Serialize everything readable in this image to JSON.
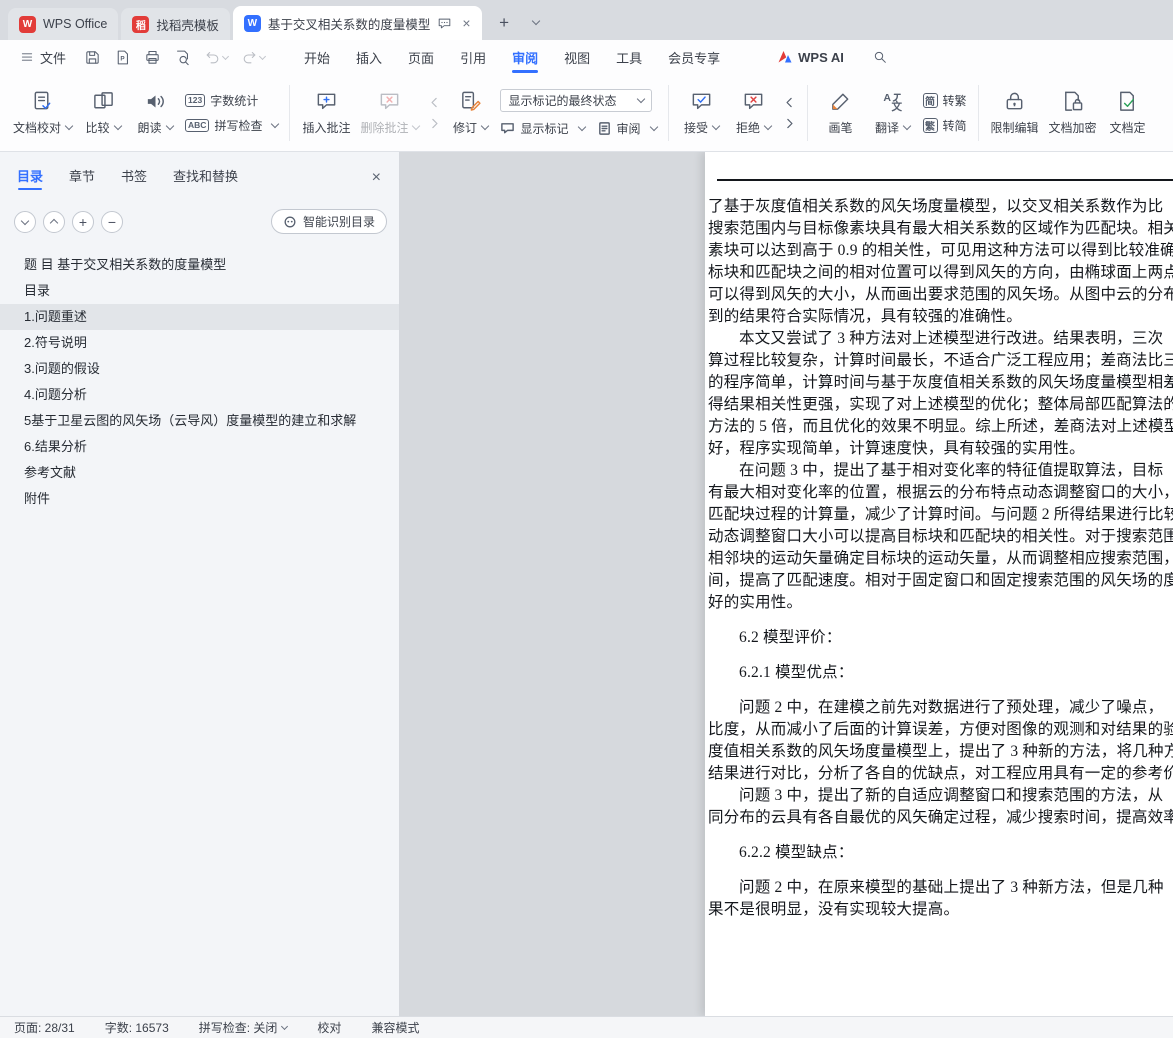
{
  "colors": {
    "accent_blue": "#3370ff",
    "brand_red": "#e23c39",
    "accept_blue": "#2f6ef2",
    "reject_red": "#e04444",
    "final_green": "#2aa158",
    "pen_orange": "#e8833a"
  },
  "tabbar": {
    "wps_tab": "WPS Office",
    "template_tab": "找稻壳模板",
    "doc_tab": "基于交叉相关系数的度量模型"
  },
  "menubar": {
    "file": "文件",
    "tabs": [
      {
        "label": "开始"
      },
      {
        "label": "插入"
      },
      {
        "label": "页面"
      },
      {
        "label": "引用"
      },
      {
        "label": "审阅",
        "active": true
      },
      {
        "label": "视图"
      },
      {
        "label": "工具"
      },
      {
        "label": "会员专享"
      }
    ],
    "wps_ai": "WPS AI"
  },
  "ribbon": {
    "doc_proof": "文档校对",
    "compare": "比较",
    "read_aloud": "朗读",
    "word_count": "字数统计",
    "word_count_badge": "123",
    "spell_check": "拼写检查",
    "spell_badge": "ABC",
    "insert_comment": "插入批注",
    "delete_comment": "删除批注",
    "revise": "修订",
    "markup_state": "显示标记的最终状态",
    "show_markup": "显示标记",
    "review": "审阅",
    "accept": "接受",
    "reject": "拒绝",
    "pen": "画笔",
    "translate": "翻译",
    "simp_char": "简",
    "to_trad": "转繁",
    "trad_char": "繁",
    "to_simp": "转简",
    "restrict_edit": "限制编辑",
    "doc_encrypt": "文档加密",
    "doc_final": "文档定"
  },
  "sidebar": {
    "tabs": [
      {
        "label": "目录",
        "active": true
      },
      {
        "label": "章节"
      },
      {
        "label": "书签"
      },
      {
        "label": "查找和替换"
      }
    ],
    "smart_toc": "智能识别目录",
    "toc": [
      {
        "label": "题 目 基于交叉相关系数的度量模型"
      },
      {
        "label": "目录"
      },
      {
        "label": "1.问题重述",
        "selected": true
      },
      {
        "label": "2.符号说明"
      },
      {
        "label": "3.问题的假设"
      },
      {
        "label": "4.问题分析"
      },
      {
        "label": "5基于卫星云图的风矢场（云导风）度量模型的建立和求解"
      },
      {
        "label": "6.结果分析"
      },
      {
        "label": "参考文献"
      },
      {
        "label": "附件"
      }
    ]
  },
  "document": {
    "lines": [
      {
        "t": "了基于灰度值相关系数的风矢场度量模型，以交叉相关系数作为比"
      },
      {
        "t": "搜索范围内与目标像素块具有最大相关系数的区域作为匹配块。相关"
      },
      {
        "t": "素块可以达到高于 0.9 的相关性，可见用这种方法可以得到比较准确"
      },
      {
        "t": "标块和匹配块之间的相对位置可以得到风矢的方向，由椭球面上两点"
      },
      {
        "t": "可以得到风矢的大小，从而画出要求范围的风矢场。从图中云的分布可"
      },
      {
        "t": "到的结果符合实际情况，具有较强的准确性。"
      },
      {
        "t": "本文又尝试了 3 种方法对上述模型进行改进。结果表明，三次",
        "ind": true
      },
      {
        "t": "算过程比较复杂，计算时间最长，不适合广泛工程应用；差商法比三"
      },
      {
        "t": "的程序简单，计算时间与基于灰度值相关系数的风矢场度量模型相差"
      },
      {
        "t": "得结果相关性更强，实现了对上述模型的优化；整体局部匹配算法的"
      },
      {
        "t": "方法的 5 倍，而且优化的效果不明显。综上所述，差商法对上述模型"
      },
      {
        "t": "好，程序实现简单，计算速度快，具有较强的实用性。"
      },
      {
        "t": "在问题 3 中，提出了基于相对变化率的特征值提取算法，目标",
        "ind": true
      },
      {
        "t": "有最大相对变化率的位置，根据云的分布特点动态调整窗口的大小，"
      },
      {
        "t": "匹配块过程的计算量，减少了计算时间。与问题 2 所得结果进行比较"
      },
      {
        "t": "动态调整窗口大小可以提高目标块和匹配块的相关性。对于搜索范围"
      },
      {
        "t": "相邻块的运动矢量确定目标块的运动矢量，从而调整相应搜索范围，"
      },
      {
        "t": "间，提高了匹配速度。相对于固定窗口和固定搜索范围的风矢场的度"
      },
      {
        "t": "好的实用性。"
      },
      {
        "t": "6.2 模型评价：",
        "ind": true,
        "gap": true
      },
      {
        "t": "6.2.1 模型优点：",
        "ind": true,
        "gap": true
      },
      {
        "t": "问题 2 中，在建模之前先对数据进行了预处理，减少了噪点，",
        "ind": true,
        "gap": true
      },
      {
        "t": "比度，从而减小了后面的计算误差，方便对图像的观测和对结果的验"
      },
      {
        "t": "度值相关系数的风矢场度量模型上，提出了 3 种新的方法，将几种方"
      },
      {
        "t": "结果进行对比，分析了各自的优缺点，对工程应用具有一定的参考价"
      },
      {
        "t": "问题 3 中，提出了新的自适应调整窗口和搜索范围的方法，从",
        "ind": true
      },
      {
        "t": "同分布的云具有各自最优的风矢确定过程，减少搜索时间，提高效率"
      },
      {
        "t": "6.2.2 模型缺点：",
        "ind": true,
        "gap": true
      },
      {
        "t": "问题 2 中，在原来模型的基础上提出了 3 种新方法，但是几种",
        "ind": true,
        "gap": true
      },
      {
        "t": "果不是很明显，没有实现较大提高。"
      }
    ]
  },
  "statusbar": {
    "page": "页面: 28/31",
    "words": "字数: 16573",
    "spell": "拼写检查: 关闭",
    "proof": "校对",
    "mode": "兼容模式"
  }
}
